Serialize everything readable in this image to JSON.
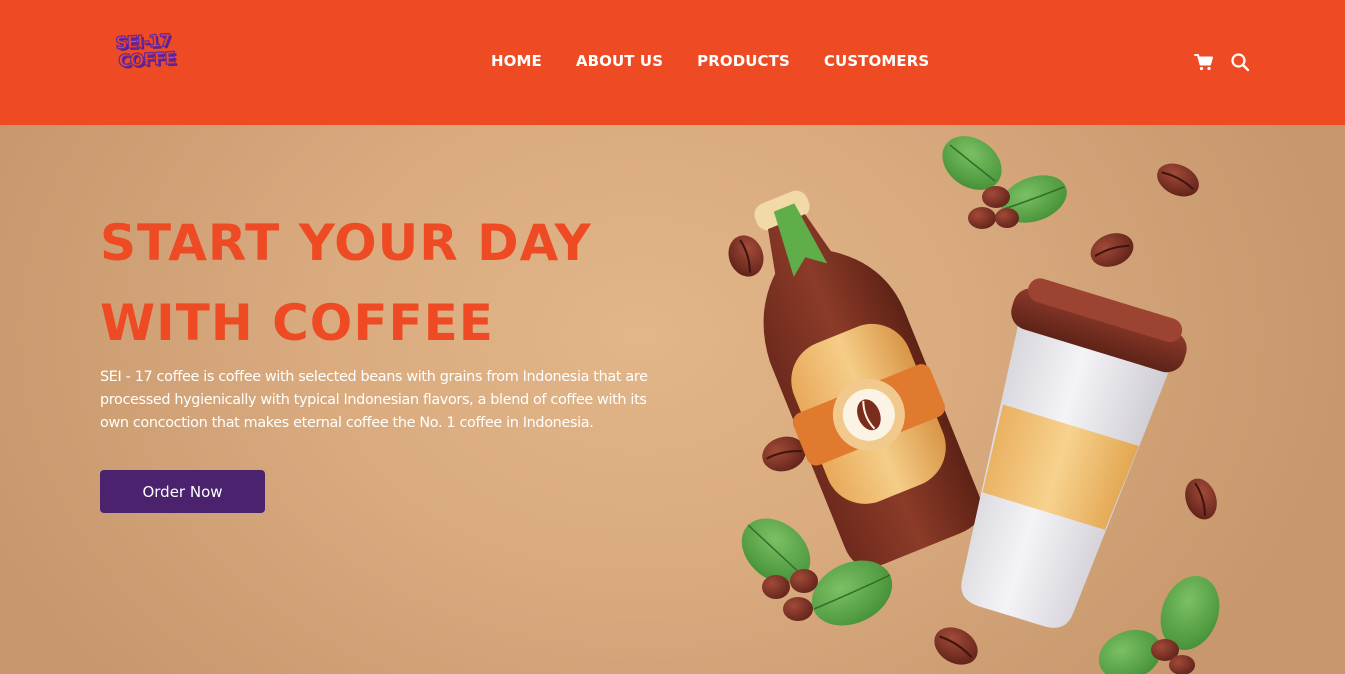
{
  "brand": {
    "logo_line1": "SEI-17",
    "logo_line2": "COFFE"
  },
  "nav": {
    "items": [
      {
        "label": "HOME"
      },
      {
        "label": "ABOUT US"
      },
      {
        "label": "PRODUCTS"
      },
      {
        "label": "CUSTOMERS"
      }
    ],
    "icons": [
      "cart-icon",
      "search-icon"
    ]
  },
  "hero": {
    "headline_line1": "START YOUR DAY",
    "headline_line2": "WITH COFFEE",
    "description": "SEI - 17 coffee is coffee with selected beans with grains from Indonesia that are processed hygienically with typical Indonesian flavors, a blend of coffee with its own concoction that makes eternal coffee the No. 1 coffee in Indonesia.",
    "cta_label": "Order Now"
  },
  "colors": {
    "navbar": "#ee4a23",
    "headline": "#ee4a23",
    "button": "#4a226d",
    "background": "#d7a77f"
  }
}
